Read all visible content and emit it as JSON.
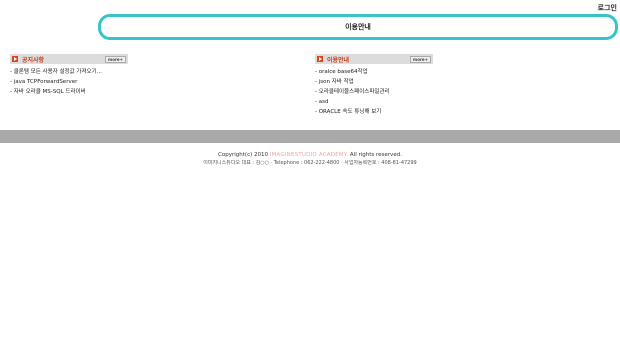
{
  "header": {
    "login_label": "로그인",
    "top_title": "이용안내"
  },
  "notices": {
    "title": "공지사항",
    "more_label": "more+",
    "items": [
      "- 클론템 모든 사용자 설정값 가져오기...",
      "- java TCPForwardServer",
      "- 자바 오라클 MS-SQL 드라이버"
    ]
  },
  "guide": {
    "title": "이용안내",
    "more_label": "more+",
    "items": [
      "- oralce base64작업",
      "- json 자바 작업",
      "- 오라클테이블스페이스파일관리",
      "- asd",
      "- ORACLE 속도 튜닝해 보기"
    ]
  },
  "footer": {
    "copyright_prefix": "Copyright(c) 2010",
    "copyright_brand": "IMAGINESTUDIO ACADEMY.",
    "copyright_suffix": "All rights reserved.",
    "info_line": "이미지니스튜디오 대표 : 김○○  ·  Telephone : 062-222-4800  ·  사업자등록번호 : 408-81-47299"
  },
  "colors": {
    "accent": "#37c3c7",
    "panel_icon": "#d8461b",
    "footer_band": "#a9a9a9"
  }
}
